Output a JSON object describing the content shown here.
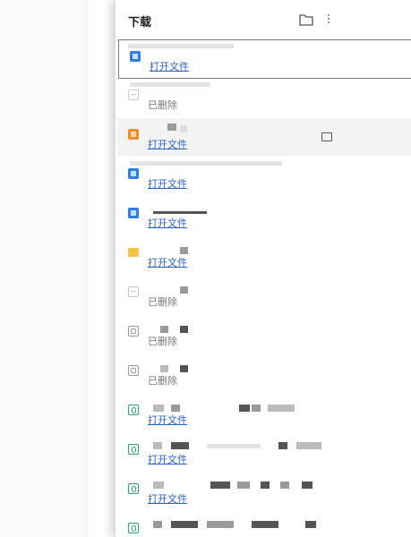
{
  "panel": {
    "title": "下载",
    "icons": {
      "folder": "folder-icon",
      "more": "more-icon"
    }
  },
  "items": [
    {
      "type": "word",
      "status": "打开文件",
      "link": true
    },
    {
      "type": "deleted",
      "status": "已删除",
      "link": false
    },
    {
      "type": "ppt",
      "status": "打开文件",
      "link": true
    },
    {
      "type": "word",
      "status": "打开文件",
      "link": true
    },
    {
      "type": "word",
      "status": "打开文件",
      "link": true
    },
    {
      "type": "folder",
      "status": "打开文件",
      "link": true
    },
    {
      "type": "deleted",
      "status": "已删除",
      "link": false
    },
    {
      "type": "archive",
      "status": "已删除",
      "link": false
    },
    {
      "type": "archive",
      "status": "已删除",
      "link": false
    },
    {
      "type": "sheet",
      "status": "打开文件",
      "link": true
    },
    {
      "type": "sheet",
      "status": "打开文件",
      "link": true
    },
    {
      "type": "sheet",
      "status": "打开文件",
      "link": true
    }
  ],
  "colors": {
    "link": "#2b61c7",
    "muted": "#777777",
    "selected_border": "#7b7b7b"
  }
}
